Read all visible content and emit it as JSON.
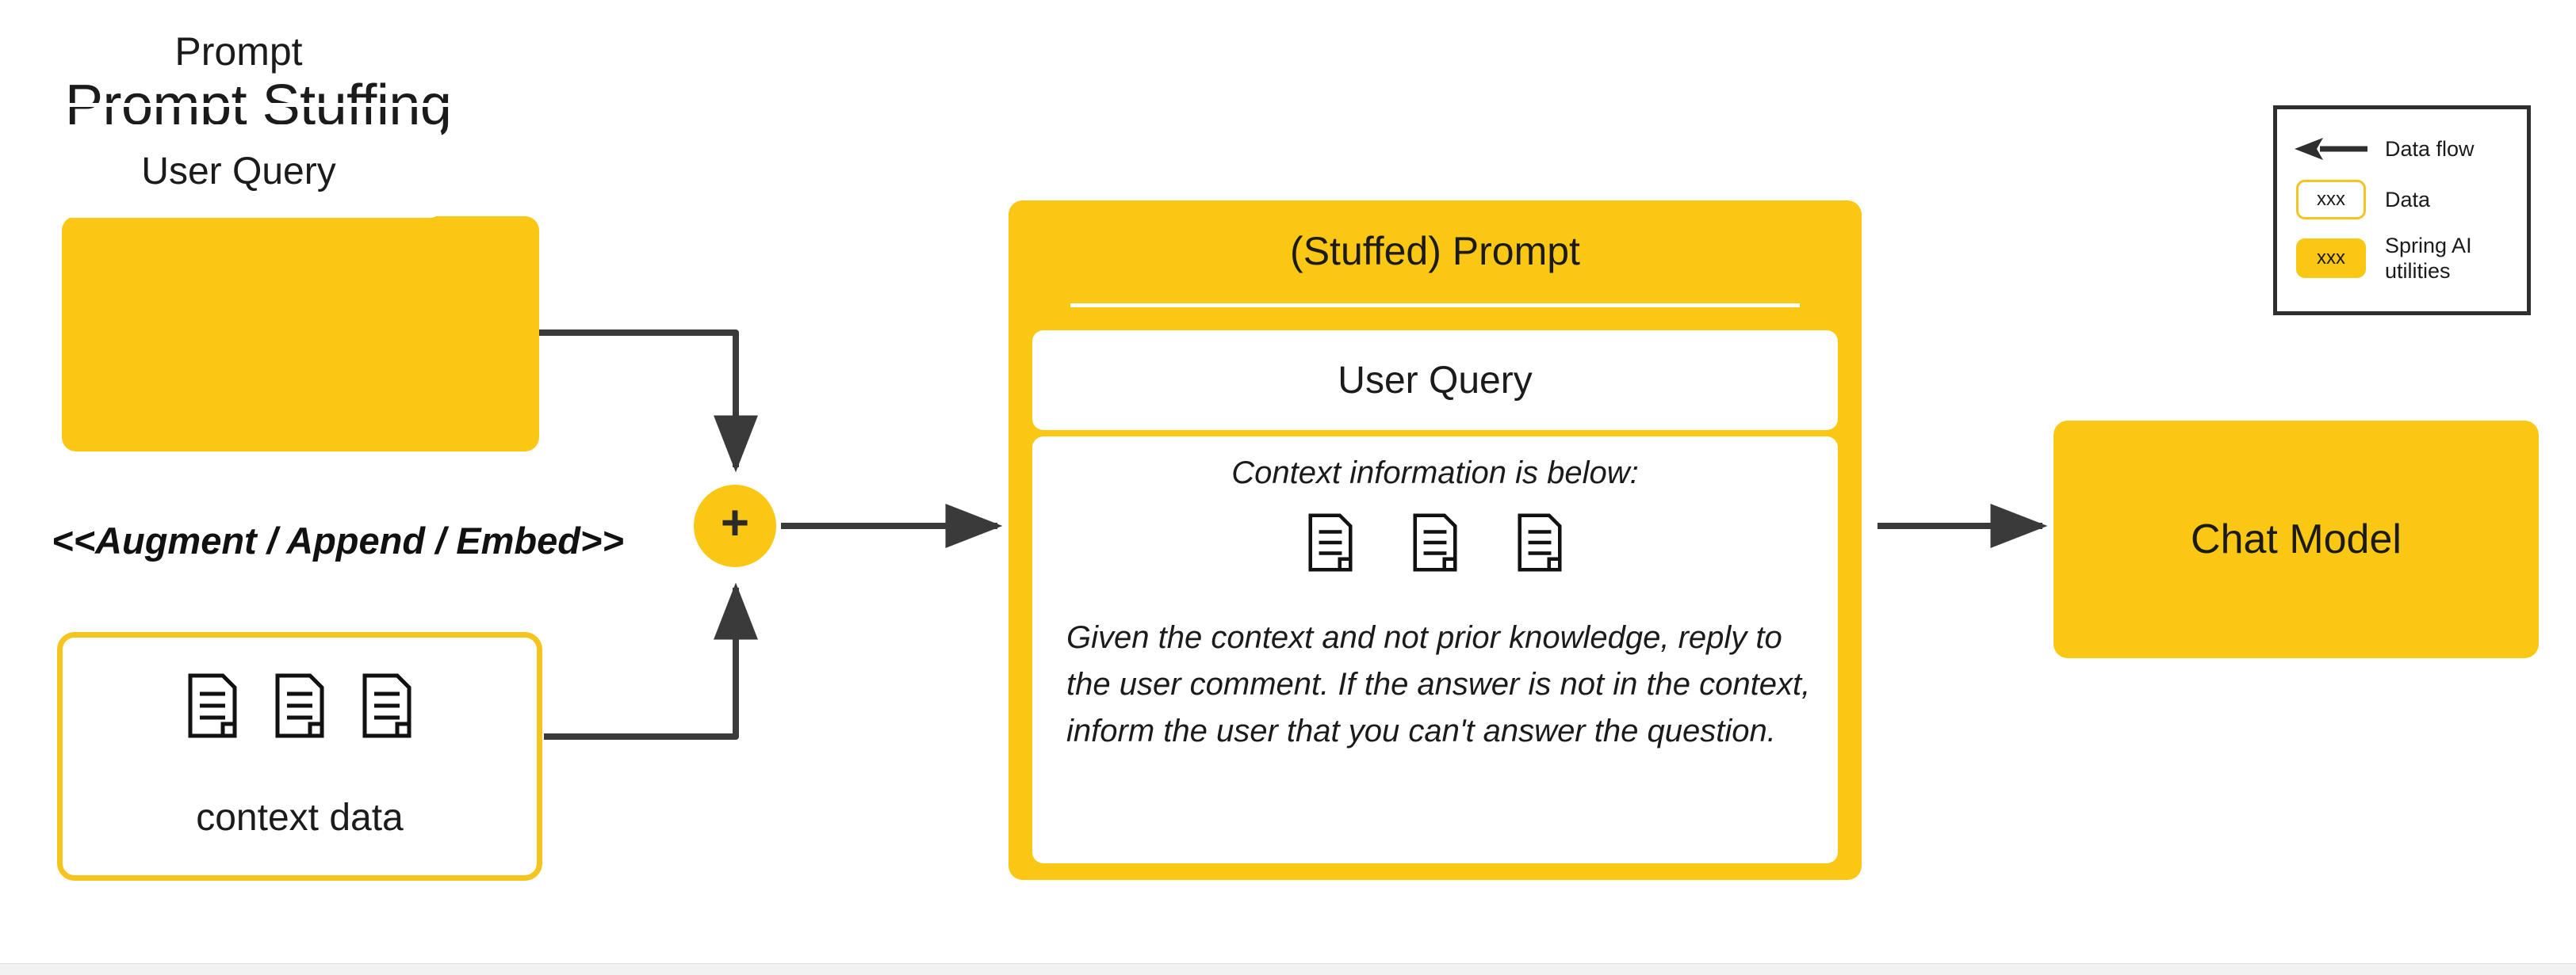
{
  "page": {
    "title": "Prompt Stuffing",
    "background": "#ffffff",
    "accent_yellow": "#FAC714",
    "accent_yellow_border": "#F5C41E",
    "arrow_color": "#3a3a3a",
    "text_color": "#1b1b1b"
  },
  "prompt_card": {
    "title": "Prompt",
    "user_query": "User Query"
  },
  "connector": {
    "augment_label": "<<Augment / Append / Embed>>",
    "merge_symbol": "+"
  },
  "context_data": {
    "label": "context data",
    "doc_count": 3,
    "doc_icon": "document-icon"
  },
  "stuffed_prompt": {
    "title": "(Stuffed) Prompt",
    "user_query": "User Query",
    "context_heading": "Context information is below:",
    "doc_count": 3,
    "doc_icon": "document-icon",
    "instruction": "Given the context and not prior knowledge, reply to the user comment. If the answer is not in the context, inform the user that you can't answer the question."
  },
  "chat_model": {
    "label": "Chat Model"
  },
  "legend": {
    "rows": [
      {
        "symbol": "arrow-left-icon",
        "chip": null,
        "label": "Data flow"
      },
      {
        "symbol": "data-chip",
        "chip": "xxx",
        "label": "Data"
      },
      {
        "symbol": "spring-chip",
        "chip": "xxx",
        "label": "Spring AI\nutilities"
      }
    ],
    "spring_label_line1": "Spring AI",
    "spring_label_line2": "utilities",
    "data_label": "Data",
    "flow_label": "Data flow",
    "chip_text": "xxx"
  }
}
